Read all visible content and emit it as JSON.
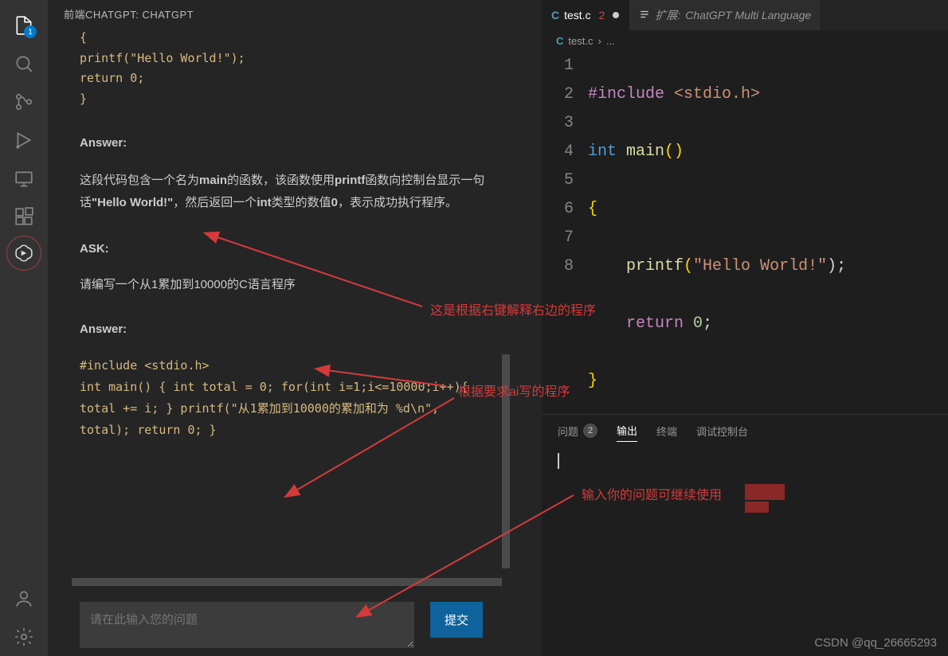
{
  "activity": {
    "explorer_badge": "1"
  },
  "panel": {
    "title": "前端CHATGPT: CHATGPT"
  },
  "chat": {
    "snippet_line1": "{",
    "snippet_line2": "    printf(\"Hello World!\");",
    "snippet_line3": "    return 0;",
    "snippet_line4": "}",
    "answer1_label": "Answer:",
    "answer1_p1": "这段代码包含一个名为",
    "answer1_b1": "main",
    "answer1_p2": "的函数，该函数使用",
    "answer1_b2": "printf",
    "answer1_p3": "函数向控制台显示一句话",
    "answer1_b3": "\"Hello World!\"",
    "answer1_p4": "，然后返回一个",
    "answer1_b4": "int",
    "answer1_p5": "类型的数值",
    "answer1_b5": "0",
    "answer1_p6": "，表示成功执行程序。",
    "ask_label": "ASK:",
    "ask_text": "请编写一个从1累加到10000的C语言程序",
    "answer2_label": "Answer:",
    "code2_l1": "#include <stdio.h>",
    "code2_l2": "int main() { int total = 0; for(int i=1;i<=10000;i++){",
    "code2_l3": "total += i; } printf(\"从1累加到10000的累加和为 %d\\n\",",
    "code2_l4": "total); return 0; }",
    "input_placeholder": "请在此输入您的问题",
    "submit_label": "提交"
  },
  "tabs": {
    "file_icon": "C",
    "tab1_name": "test.c",
    "tab1_badge": "2",
    "tab2_prefix": "扩展:",
    "tab2_name": "ChatGPT Multi Language"
  },
  "breadcrumb": {
    "file": "test.c",
    "sep": "›",
    "rest": "..."
  },
  "editor": {
    "lines": [
      "1",
      "2",
      "3",
      "4",
      "5",
      "6",
      "7",
      "8"
    ],
    "l1_a": "#include",
    "l1_b": " <stdio.h>",
    "l2_a": "int",
    "l2_b": " main",
    "l2_c": "()",
    "l3": "{",
    "l4_a": "    printf",
    "l4_b": "(",
    "l4_c": "\"Hello World!\"",
    "l4_d": ");",
    "l5_a": "    ",
    "l5_b": "return",
    "l5_c": " ",
    "l5_d": "0",
    "l5_e": ";",
    "l6": "}"
  },
  "bottom": {
    "tab_problems": "问题",
    "tab_problems_count": "2",
    "tab_output": "输出",
    "tab_terminal": "终端",
    "tab_debug": "调试控制台"
  },
  "annotations": {
    "a1": "这是根据右键解释右边的程序",
    "a2": "根据要求ai写的程序",
    "a3": "输入你的问题可继续使用"
  },
  "watermark": "CSDN @qq_26665293"
}
